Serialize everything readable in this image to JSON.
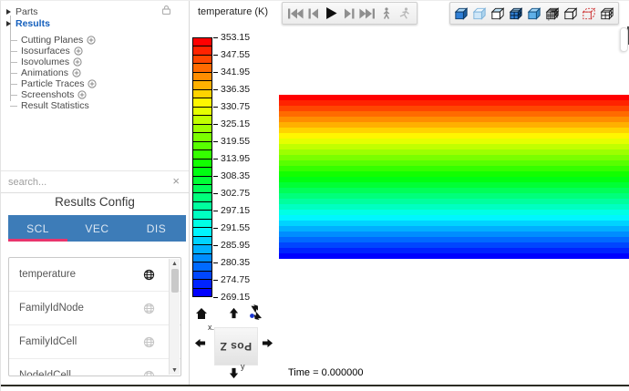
{
  "sidebar": {
    "tree": {
      "items": [
        {
          "label": "Parts",
          "type": "branch",
          "add": false,
          "selected": false
        },
        {
          "label": "Results",
          "type": "branch",
          "add": false,
          "selected": true
        },
        {
          "label": "Cutting Planes",
          "type": "leaf",
          "add": true,
          "selected": false
        },
        {
          "label": "Isosurfaces",
          "type": "leaf",
          "add": true,
          "selected": false
        },
        {
          "label": "Isovolumes",
          "type": "leaf",
          "add": true,
          "selected": false
        },
        {
          "label": "Animations",
          "type": "leaf",
          "add": true,
          "selected": false
        },
        {
          "label": "Particle Traces",
          "type": "leaf",
          "add": true,
          "selected": false
        },
        {
          "label": "Screenshots",
          "type": "leaf",
          "add": true,
          "selected": false
        },
        {
          "label": "Result Statistics",
          "type": "leaf",
          "add": false,
          "selected": false
        }
      ]
    },
    "search": {
      "placeholder": "search...",
      "clear_glyph": "×"
    },
    "results_config": {
      "title": "Results Config",
      "tab_bar_color": "#3d7cb8",
      "active_underline_color": "#e8356d",
      "tabs": [
        {
          "label": "SCL",
          "active": true
        },
        {
          "label": "VEC",
          "active": false
        },
        {
          "label": "DIS",
          "active": false
        }
      ],
      "variables": [
        {
          "name": "temperature",
          "selected": true,
          "clipped": false
        },
        {
          "name": "FamilyIdNode",
          "selected": false,
          "clipped": false
        },
        {
          "name": "FamilyIdCell",
          "selected": false,
          "clipped": false
        },
        {
          "name": "NodeIdCell",
          "selected": false,
          "clipped": true
        }
      ]
    }
  },
  "main": {
    "colorbar": {
      "title": "temperature (K)",
      "tick_labels": [
        "353.15",
        "347.55",
        "341.95",
        "336.35",
        "330.75",
        "325.15",
        "319.55",
        "313.95",
        "308.35",
        "302.75",
        "297.15",
        "291.55",
        "285.95",
        "280.35",
        "274.75",
        "269.15"
      ],
      "levels": 30,
      "top_color": "#ff0000",
      "bottom_color": "#0000ff"
    },
    "playback": {
      "buttons": [
        {
          "name": "jump-to-start"
        },
        {
          "name": "step-back"
        },
        {
          "name": "play"
        },
        {
          "name": "step-forward"
        },
        {
          "name": "jump-to-end"
        },
        {
          "name": "walk-animate"
        },
        {
          "name": "run-animate"
        }
      ]
    },
    "view_modes": {
      "buttons": [
        {
          "name": "shaded"
        },
        {
          "name": "shaded-transparent"
        },
        {
          "name": "hidden-line"
        },
        {
          "name": "shaded-mesh"
        },
        {
          "name": "flat-shaded"
        },
        {
          "name": "mesh-fine"
        },
        {
          "name": "wireframe"
        },
        {
          "name": "points-dashed"
        },
        {
          "name": "mesh-coarse"
        }
      ]
    },
    "viewport": {
      "bands": 30
    },
    "nav": {
      "pos_button": "Pos Z",
      "x_label": "x.",
      "y_label": "y"
    },
    "time_label": "Time = 0.000000"
  }
}
